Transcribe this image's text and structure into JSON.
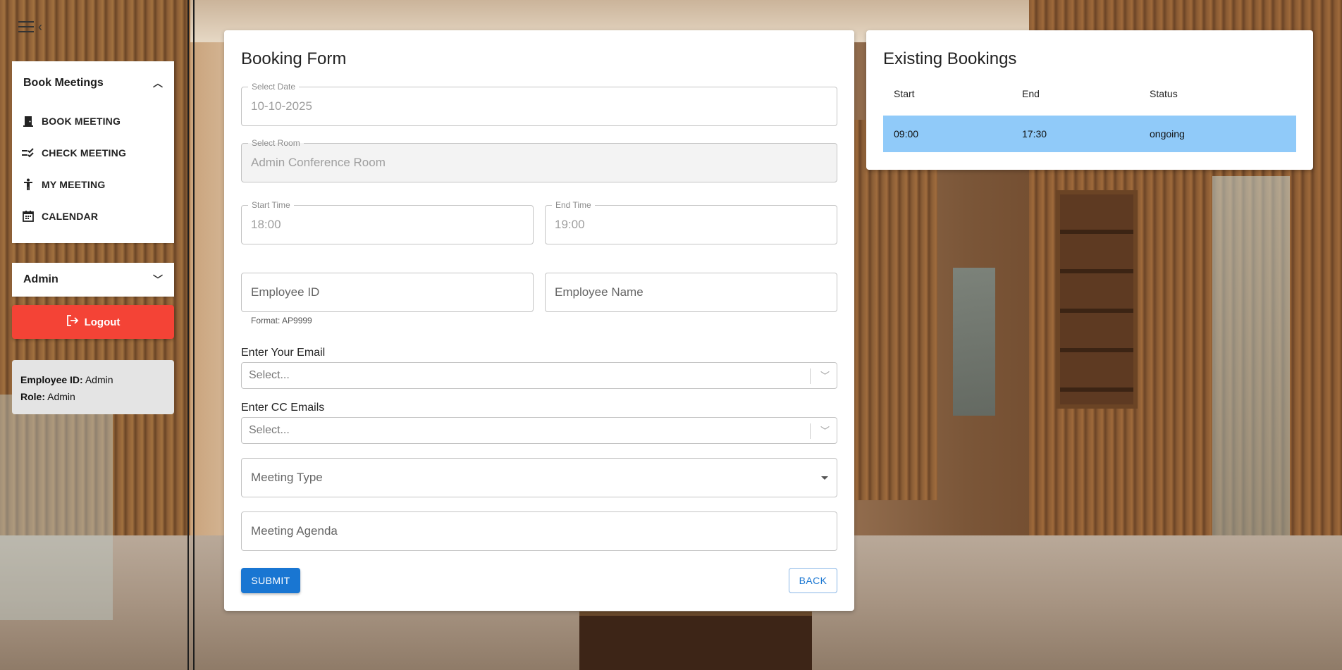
{
  "sidebar": {
    "section_title": "Book Meetings",
    "items": [
      {
        "label": "BOOK MEETING",
        "icon": "door-icon"
      },
      {
        "label": "CHECK MEETING",
        "icon": "checklist-icon"
      },
      {
        "label": "MY MEETING",
        "icon": "person-icon"
      },
      {
        "label": "CALENDAR",
        "icon": "calendar-icon"
      }
    ],
    "admin_title": "Admin",
    "logout_label": "Logout",
    "employee_id_label": "Employee ID:",
    "employee_id": "Admin",
    "role_label": "Role:",
    "role": "Admin"
  },
  "form": {
    "title": "Booking Form",
    "date_label": "Select Date",
    "date_value": "10-10-2025",
    "room_label": "Select Room",
    "room_value": "Admin Conference Room",
    "start_label": "Start Time",
    "start_value": "18:00",
    "end_label": "End Time",
    "end_value": "19:00",
    "employee_id_placeholder": "Employee ID",
    "employee_id_helper": "Format: AP9999",
    "employee_name_placeholder": "Employee Name",
    "email_label": "Enter Your Email",
    "email_placeholder": "Select...",
    "cc_label": "Enter CC Emails",
    "cc_placeholder": "Select...",
    "meeting_type_placeholder": "Meeting Type",
    "agenda_placeholder": "Meeting Agenda",
    "submit_label": "SUBMIT",
    "back_label": "BACK"
  },
  "bookings": {
    "title": "Existing Bookings",
    "columns": [
      "Start",
      "End",
      "Status"
    ],
    "rows": [
      {
        "start": "09:00",
        "end": "17:30",
        "status": "ongoing"
      }
    ],
    "row_highlight_color": "#90caf9"
  },
  "colors": {
    "primary": "#1976d2",
    "logout": "#f44336"
  }
}
